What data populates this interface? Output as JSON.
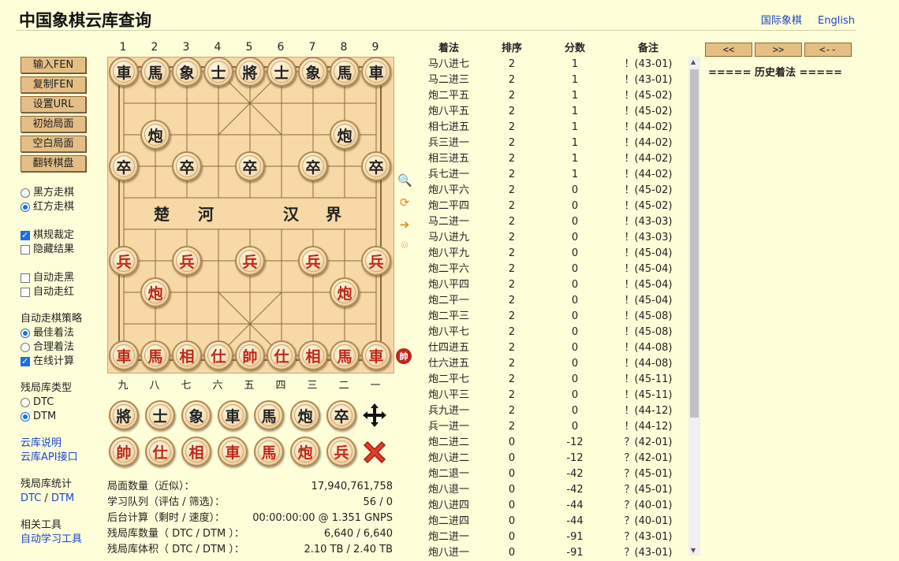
{
  "header": {
    "title": "中国象棋云库查询",
    "links": [
      "国际象棋",
      "English"
    ]
  },
  "left_panel": {
    "buttons": [
      "输入FEN",
      "复制FEN",
      "设置URL",
      "初始局面",
      "空白局面",
      "翻转棋盘"
    ],
    "turn_options": [
      "黑方走棋",
      "红方走棋"
    ],
    "rule_options": [
      "棋规裁定",
      "隐藏结果"
    ],
    "auto_options": [
      "自动走黑",
      "自动走红"
    ],
    "strategy_title": "自动走棋策略",
    "strategy_options": [
      "最佳着法",
      "合理着法",
      "在线计算"
    ],
    "endgame_title": "残局库类型",
    "endgame_options": [
      "DTC",
      "DTM"
    ],
    "links": [
      "云库说明",
      "云库API接口"
    ],
    "stats_title": "残局库统计",
    "stats_link_a": "DTC",
    "stats_sep": "/",
    "stats_link_b": "DTM",
    "tools_title": "相关工具",
    "tools_link": "自动学习工具"
  },
  "board": {
    "col_numbers": [
      "1",
      "2",
      "3",
      "4",
      "5",
      "6",
      "7",
      "8",
      "9"
    ],
    "col_chinese": [
      "九",
      "八",
      "七",
      "六",
      "五",
      "四",
      "三",
      "二",
      "一"
    ],
    "river": [
      "楚",
      "河",
      "汉",
      "界"
    ],
    "pieces": [
      {
        "c": "b",
        "t": "車",
        "col": 0,
        "row": 0
      },
      {
        "c": "b",
        "t": "馬",
        "col": 1,
        "row": 0
      },
      {
        "c": "b",
        "t": "象",
        "col": 2,
        "row": 0
      },
      {
        "c": "b",
        "t": "士",
        "col": 3,
        "row": 0
      },
      {
        "c": "b",
        "t": "將",
        "col": 4,
        "row": 0
      },
      {
        "c": "b",
        "t": "士",
        "col": 5,
        "row": 0
      },
      {
        "c": "b",
        "t": "象",
        "col": 6,
        "row": 0
      },
      {
        "c": "b",
        "t": "馬",
        "col": 7,
        "row": 0
      },
      {
        "c": "b",
        "t": "車",
        "col": 8,
        "row": 0
      },
      {
        "c": "b",
        "t": "炮",
        "col": 1,
        "row": 2
      },
      {
        "c": "b",
        "t": "炮",
        "col": 7,
        "row": 2
      },
      {
        "c": "b",
        "t": "卒",
        "col": 0,
        "row": 3
      },
      {
        "c": "b",
        "t": "卒",
        "col": 2,
        "row": 3
      },
      {
        "c": "b",
        "t": "卒",
        "col": 4,
        "row": 3
      },
      {
        "c": "b",
        "t": "卒",
        "col": 6,
        "row": 3
      },
      {
        "c": "b",
        "t": "卒",
        "col": 8,
        "row": 3
      },
      {
        "c": "r",
        "t": "兵",
        "col": 0,
        "row": 6
      },
      {
        "c": "r",
        "t": "兵",
        "col": 2,
        "row": 6
      },
      {
        "c": "r",
        "t": "兵",
        "col": 4,
        "row": 6
      },
      {
        "c": "r",
        "t": "兵",
        "col": 6,
        "row": 6
      },
      {
        "c": "r",
        "t": "兵",
        "col": 8,
        "row": 6
      },
      {
        "c": "r",
        "t": "炮",
        "col": 1,
        "row": 7
      },
      {
        "c": "r",
        "t": "炮",
        "col": 7,
        "row": 7
      },
      {
        "c": "r",
        "t": "車",
        "col": 0,
        "row": 9
      },
      {
        "c": "r",
        "t": "馬",
        "col": 1,
        "row": 9
      },
      {
        "c": "r",
        "t": "相",
        "col": 2,
        "row": 9
      },
      {
        "c": "r",
        "t": "仕",
        "col": 3,
        "row": 9
      },
      {
        "c": "r",
        "t": "帥",
        "col": 4,
        "row": 9
      },
      {
        "c": "r",
        "t": "仕",
        "col": 5,
        "row": 9
      },
      {
        "c": "r",
        "t": "相",
        "col": 6,
        "row": 9
      },
      {
        "c": "r",
        "t": "馬",
        "col": 7,
        "row": 9
      },
      {
        "c": "r",
        "t": "車",
        "col": 8,
        "row": 9
      }
    ],
    "turn_marker": "帥"
  },
  "palette": {
    "black": [
      "將",
      "士",
      "象",
      "車",
      "馬",
      "炮",
      "卒"
    ],
    "red": [
      "帥",
      "仕",
      "相",
      "車",
      "馬",
      "炮",
      "兵"
    ]
  },
  "stats": [
    {
      "label": "局面数量（近似）：",
      "value": "17,940,761,758"
    },
    {
      "label": "学习队列（评估 / 筛选）：",
      "value": "56 / 0"
    },
    {
      "label": "后台计算（剩时 / 速度）：",
      "value": "00:00:00:00 @ 1.351 GNPS"
    },
    {
      "label": "残局库数量（ DTC / DTM ）：",
      "value": "6,640 / 6,640"
    },
    {
      "label": "残局库体积（ DTC / DTM ）：",
      "value": "2.10 TB / 2.40 TB"
    }
  ],
  "moves_header": [
    "着法",
    "排序",
    "分数",
    "备注"
  ],
  "moves": [
    [
      "马八进七",
      "2",
      "1",
      "！(43-01)"
    ],
    [
      "马二进三",
      "2",
      "1",
      "！(43-01)"
    ],
    [
      "炮二平五",
      "2",
      "1",
      "！(45-02)"
    ],
    [
      "炮八平五",
      "2",
      "1",
      "！(45-02)"
    ],
    [
      "相七进五",
      "2",
      "1",
      "！(44-02)"
    ],
    [
      "兵三进一",
      "2",
      "1",
      "！(44-02)"
    ],
    [
      "相三进五",
      "2",
      "1",
      "！(44-02)"
    ],
    [
      "兵七进一",
      "2",
      "1",
      "！(44-02)"
    ],
    [
      "炮八平六",
      "2",
      "0",
      "！(45-02)"
    ],
    [
      "炮二平四",
      "2",
      "0",
      "！(45-02)"
    ],
    [
      "马二进一",
      "2",
      "0",
      "！(43-03)"
    ],
    [
      "马八进九",
      "2",
      "0",
      "！(43-03)"
    ],
    [
      "炮八平九",
      "2",
      "0",
      "！(45-04)"
    ],
    [
      "炮二平六",
      "2",
      "0",
      "！(45-04)"
    ],
    [
      "炮八平四",
      "2",
      "0",
      "！(45-04)"
    ],
    [
      "炮二平一",
      "2",
      "0",
      "！(45-04)"
    ],
    [
      "炮二平三",
      "2",
      "0",
      "！(45-08)"
    ],
    [
      "炮八平七",
      "2",
      "0",
      "！(45-08)"
    ],
    [
      "仕四进五",
      "2",
      "0",
      "！(44-08)"
    ],
    [
      "仕六进五",
      "2",
      "0",
      "！(44-08)"
    ],
    [
      "炮二平七",
      "2",
      "0",
      "！(45-11)"
    ],
    [
      "炮八平三",
      "2",
      "0",
      "！(45-11)"
    ],
    [
      "兵九进一",
      "2",
      "0",
      "！(44-12)"
    ],
    [
      "兵一进一",
      "2",
      "0",
      "！(44-12)"
    ],
    [
      "炮二进二",
      "0",
      "-12",
      "？(42-01)"
    ],
    [
      "炮八进二",
      "0",
      "-12",
      "？(42-01)"
    ],
    [
      "炮二退一",
      "0",
      "-42",
      "？(45-01)"
    ],
    [
      "炮八退一",
      "0",
      "-42",
      "？(45-01)"
    ],
    [
      "炮八进四",
      "0",
      "-44",
      "？(40-01)"
    ],
    [
      "炮二进四",
      "0",
      "-44",
      "？(40-01)"
    ],
    [
      "炮二进一",
      "0",
      "-91",
      "？(43-01)"
    ],
    [
      "炮八进一",
      "0",
      "-91",
      "？(43-01)"
    ]
  ],
  "nav_buttons": [
    "<<",
    ">>",
    "<--"
  ],
  "history_label": "===== 历史着法 =====",
  "colors": {
    "background": "#fefed9",
    "button": "#e4be84",
    "board": "#f6d9a6",
    "red_piece": "#c0261b",
    "link": "#1a46c8"
  }
}
